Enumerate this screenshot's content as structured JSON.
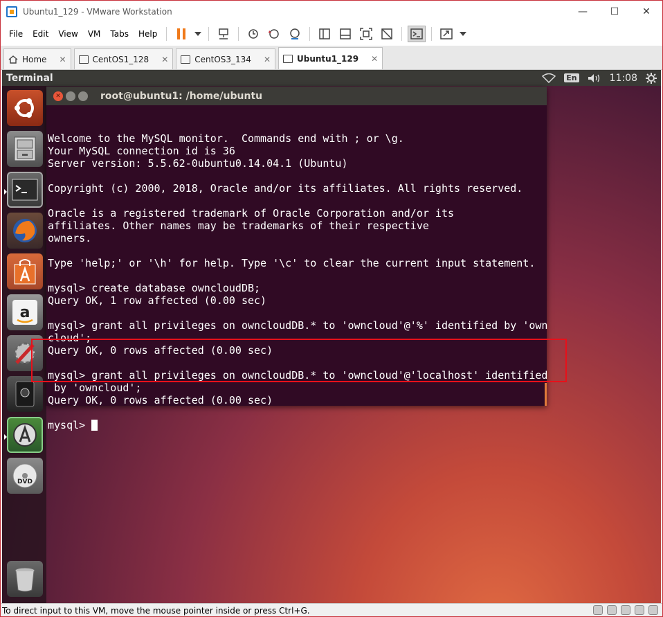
{
  "window": {
    "title": "Ubuntu1_129 - VMware Workstation",
    "min_label": "—",
    "max_label": "☐",
    "close_label": "✕"
  },
  "menu": [
    "File",
    "Edit",
    "View",
    "VM",
    "Tabs",
    "Help"
  ],
  "tabs": [
    {
      "label": "Home",
      "active": false
    },
    {
      "label": "CentOS1_128",
      "active": false
    },
    {
      "label": "CentOS3_134",
      "active": false
    },
    {
      "label": "Ubuntu1_129",
      "active": true
    }
  ],
  "tab_close_glyph": "✕",
  "ubuntu_panel": {
    "title": "Terminal",
    "keyboard": "En",
    "time": "11:08"
  },
  "terminal": {
    "title": "root@ubuntu1: /home/ubuntu",
    "lines": [
      "Welcome to the MySQL monitor.  Commands end with ; or \\g.",
      "Your MySQL connection id is 36",
      "Server version: 5.5.62-0ubuntu0.14.04.1 (Ubuntu)",
      "",
      "Copyright (c) 2000, 2018, Oracle and/or its affiliates. All rights reserved.",
      "",
      "Oracle is a registered trademark of Oracle Corporation and/or its",
      "affiliates. Other names may be trademarks of their respective",
      "owners.",
      "",
      "Type 'help;' or '\\h' for help. Type '\\c' to clear the current input statement.",
      "",
      "mysql> create database owncloudDB;",
      "Query OK, 1 row affected (0.00 sec)",
      "",
      "mysql> grant all privileges on owncloudDB.* to 'owncloud'@'%' identified by 'own",
      "cloud';",
      "Query OK, 0 rows affected (0.00 sec)",
      "",
      "mysql> grant all privileges on owncloudDB.* to 'owncloud'@'localhost' identified",
      " by 'owncloud';",
      "Query OK, 0 rows affected (0.00 sec)",
      ""
    ],
    "prompt": "mysql> "
  },
  "status_text": "To direct input to this VM, move the mouse pointer inside or press Ctrl+G."
}
